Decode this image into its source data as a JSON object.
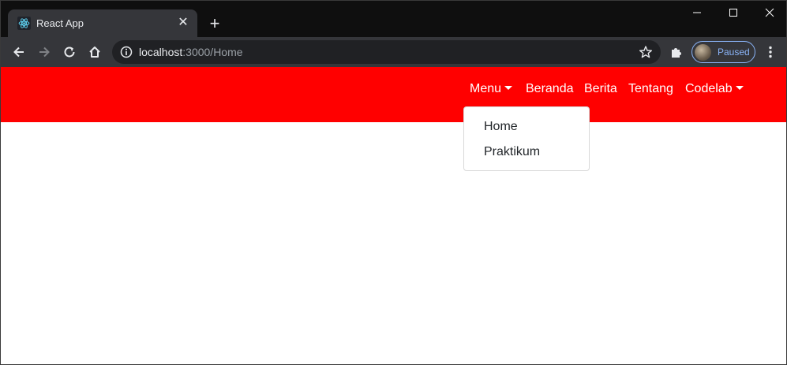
{
  "browser": {
    "tab": {
      "title": "React App",
      "favicon": "react-icon"
    },
    "new_tab_label": "+",
    "window_controls": [
      "minimize-icon",
      "maximize-icon",
      "close-icon"
    ],
    "toolbar": {
      "url_host": "localhost",
      "url_path": ":3000/Home",
      "profile_status": "Paused"
    }
  },
  "navbar": {
    "background": "#ff0000",
    "items": [
      {
        "label": "Menu",
        "dropdown": true
      },
      {
        "label": "Beranda",
        "dropdown": false
      },
      {
        "label": "Berita",
        "dropdown": false
      },
      {
        "label": "Tentang",
        "dropdown": false
      },
      {
        "label": "Codelab",
        "dropdown": true
      }
    ]
  },
  "dropdown_menu": {
    "items": [
      "Home",
      "Praktikum"
    ]
  }
}
